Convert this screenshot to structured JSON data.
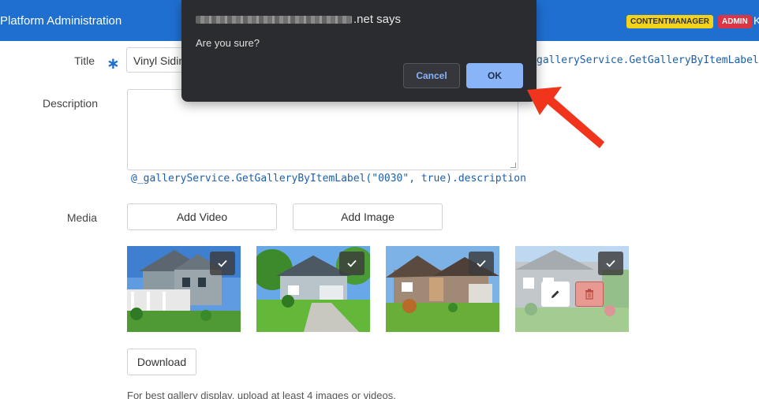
{
  "header": {
    "app_title": "Platform Administration",
    "badges": {
      "content_manager": "CONTENTMANAGER",
      "admin": "ADMIN"
    },
    "user_initial": "K"
  },
  "form": {
    "title_label": "Title",
    "required_mark": "∗",
    "title_value": "Vinyl Siding",
    "title_binding_fragment": "galleryService.GetGalleryByItemLabel",
    "description_label": "Description",
    "description_value": "",
    "description_binding": "@_galleryService.GetGalleryByItemLabel(\"0030\", true).description",
    "media_label": "Media",
    "add_video": "Add Video",
    "add_image": "Add Image",
    "download": "Download",
    "hint": "For best gallery display, upload at least 4 images or videos."
  },
  "media": [
    {
      "name": "house-photo-1",
      "selected": true
    },
    {
      "name": "house-photo-2",
      "selected": true
    },
    {
      "name": "house-photo-3",
      "selected": true
    },
    {
      "name": "house-photo-4",
      "selected": true,
      "hovered": true
    }
  ],
  "dialog": {
    "origin_suffix": ".net says",
    "message": "Are you sure?",
    "cancel": "Cancel",
    "ok": "OK"
  },
  "colors": {
    "header_blue": "#1f6fd1",
    "badge_yellow": "#f2d21b",
    "badge_red": "#dc3545",
    "dialog_bg": "#2b2c2f",
    "ok_blue": "#8ab4f8",
    "annotation_red": "#f0351c"
  },
  "icons": {
    "check": "check-icon",
    "edit": "pencil-icon",
    "delete": "trash-icon",
    "pointer": "red-arrow-annotation"
  }
}
